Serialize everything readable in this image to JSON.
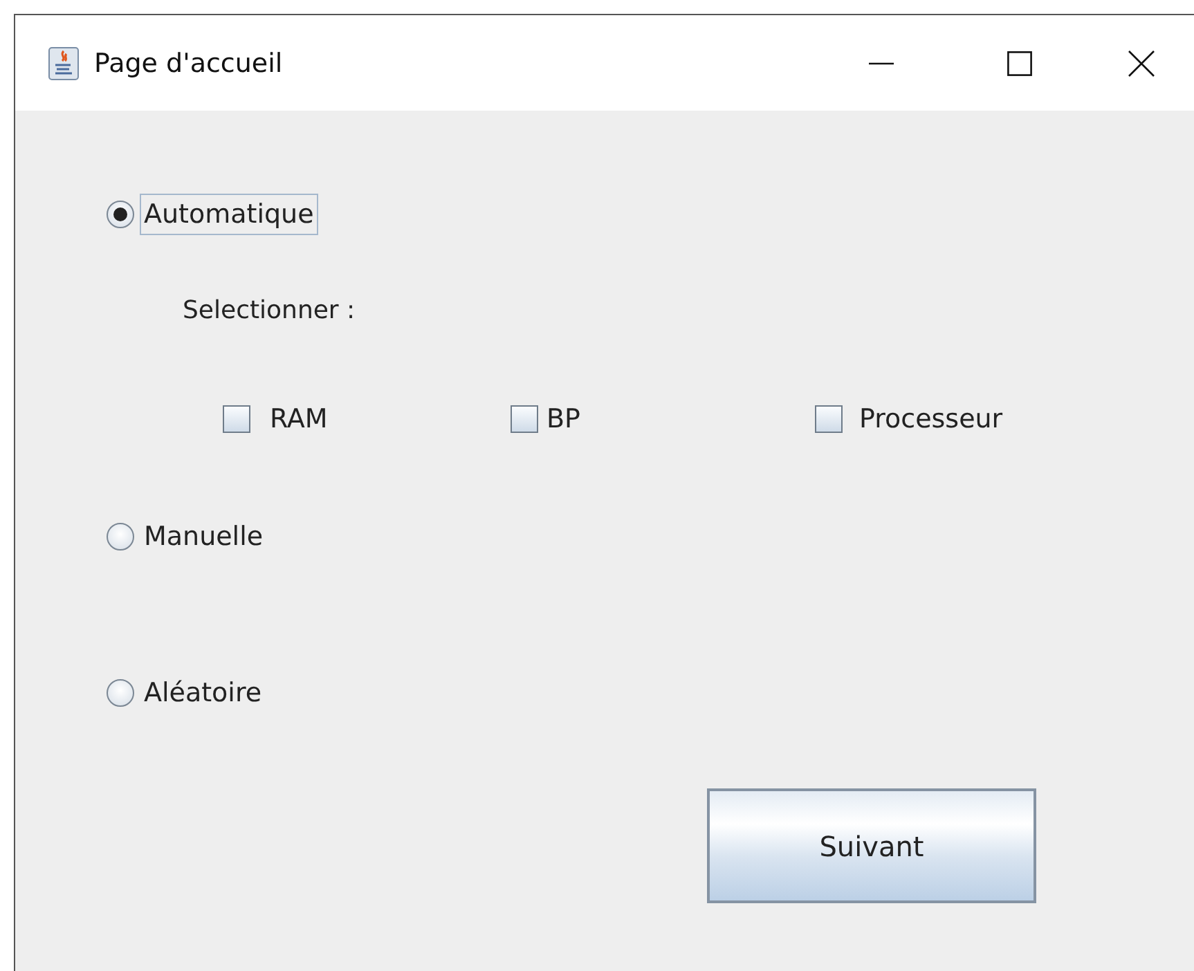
{
  "window": {
    "title": "Page d'accueil"
  },
  "options": [
    {
      "label": "Automatique",
      "selected": true,
      "focused": true,
      "details": {
        "prompt": "Selectionner :",
        "checkboxes": [
          {
            "label": "RAM",
            "checked": false
          },
          {
            "label": "BP",
            "checked": false
          },
          {
            "label": "Processeur",
            "checked": false
          }
        ]
      }
    },
    {
      "label": "Manuelle",
      "selected": false,
      "focused": false
    },
    {
      "label": "Aléatoire",
      "selected": false,
      "focused": false
    }
  ],
  "button": {
    "label": "Suivant"
  }
}
